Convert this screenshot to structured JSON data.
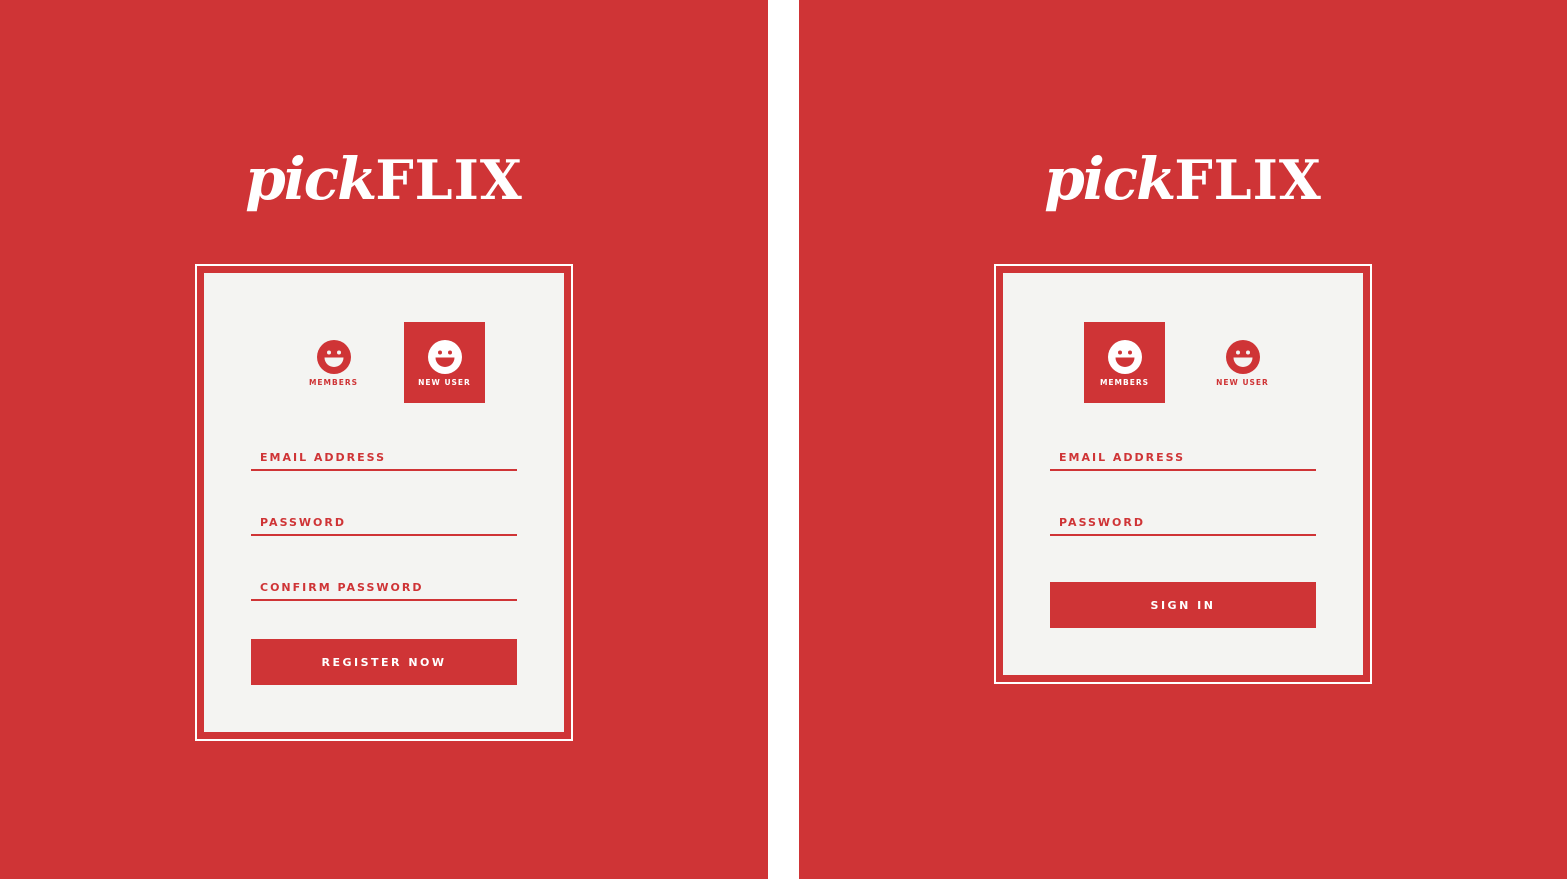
{
  "brand": {
    "script_part": "pick",
    "block_part": "FLIX"
  },
  "colors": {
    "brand_red": "#cf3436",
    "card_bg": "#f4f4f2",
    "text_white": "#ffffff"
  },
  "register_screen": {
    "tabs": [
      {
        "label": "MEMBERS",
        "icon": "smiley-icon",
        "active": false
      },
      {
        "label": "NEW USER",
        "icon": "smiley-icon",
        "active": true
      }
    ],
    "fields": [
      {
        "placeholder": "EMAIL ADDRESS",
        "value": ""
      },
      {
        "placeholder": "PASSWORD",
        "value": ""
      },
      {
        "placeholder": "CONFIRM PASSWORD",
        "value": ""
      }
    ],
    "submit_label": "REGISTER NOW"
  },
  "signin_screen": {
    "tabs": [
      {
        "label": "MEMBERS",
        "icon": "smiley-icon",
        "active": true
      },
      {
        "label": "NEW USER",
        "icon": "smiley-icon",
        "active": false
      }
    ],
    "fields": [
      {
        "placeholder": "EMAIL ADDRESS",
        "value": ""
      },
      {
        "placeholder": "PASSWORD",
        "value": ""
      }
    ],
    "submit_label": "SIGN IN"
  }
}
